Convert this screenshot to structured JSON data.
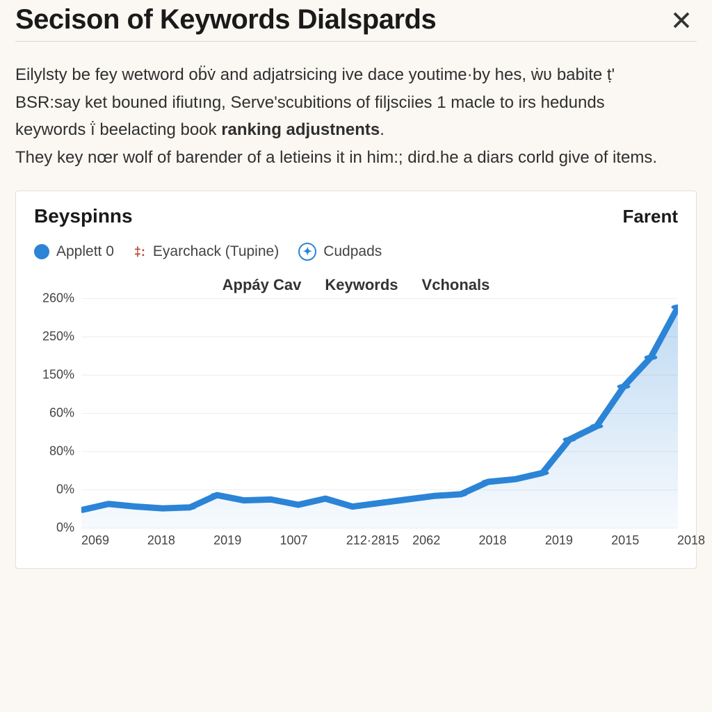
{
  "header": {
    "title": "Secison of Keywords Dialspards",
    "close_label": "Close"
  },
  "body": {
    "line1_a": "Eilylsty be fey wetword ob̈v̇ and adjatrsicing ive dace youtime·by hes, ẇʋ babite ",
    "line1_b": "ṭ'",
    "line2": "BSR:say ket bouned ifiutıng, Serve'scubitions of filjsciies 1 macle to irs hedunds",
    "line3_a": "keywords ",
    "line3_b": "ï̇",
    "line3_c": " beelacting book ",
    "line3_bold": "ranking adjustnents",
    "line3_d": ".",
    "line4": "They key nœr wolf of barender of a letieins it in him:; diɾd.he a diars corld give of items."
  },
  "card": {
    "title": "Beyspinns",
    "right_label": "Farent",
    "legend": {
      "a": "Applett 0",
      "b_prefix": "‡:",
      "b": "Eyarchack (Tupine)",
      "c": "Cudpads"
    },
    "tabs": {
      "a": "Appáy Cav",
      "b": "Keywords",
      "c": "Vchonals"
    }
  },
  "chart_data": {
    "type": "area",
    "title": "Beyspinns",
    "xlabel": "",
    "ylabel": "",
    "y_ticks": [
      "260%",
      "250%",
      "150%",
      "60%",
      "80%",
      "0%",
      "0%"
    ],
    "categories": [
      "2069",
      "2018",
      "2019",
      "1007",
      "212·2815",
      "2062",
      "2018",
      "2019",
      "2015",
      "2018"
    ],
    "series": [
      {
        "name": "Applett 0",
        "color": "#2b84d6",
        "values": [
          20,
          27,
          24,
          22,
          23,
          37,
          31,
          32,
          26,
          33,
          24,
          28,
          32,
          36,
          38,
          52,
          55,
          62,
          100,
          115,
          160,
          193,
          250
        ]
      }
    ],
    "ylim": [
      0,
      260
    ],
    "grid": true,
    "legend_position": "top-left"
  }
}
